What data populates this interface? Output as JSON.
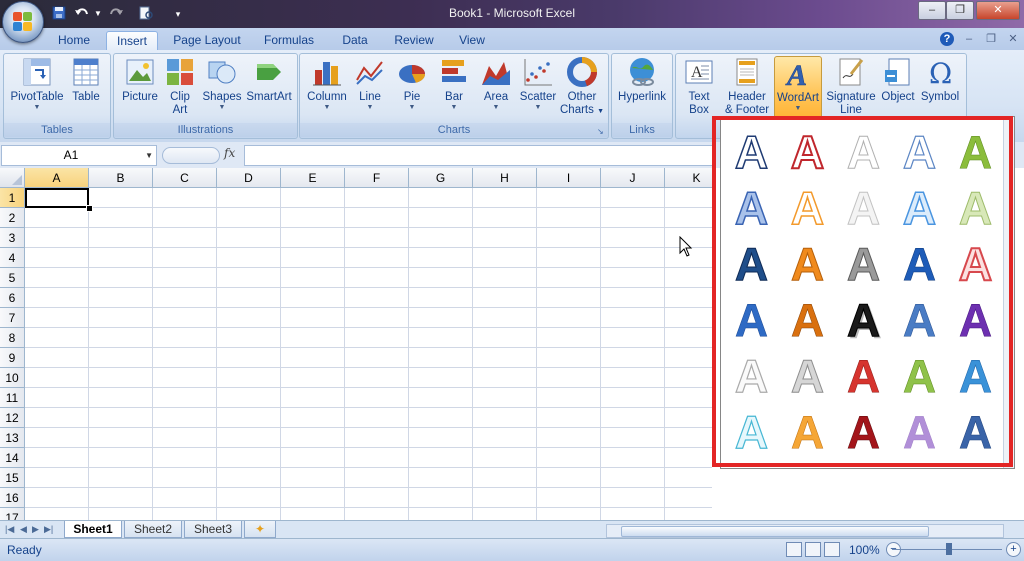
{
  "window": {
    "title": "Book1 - Microsoft Excel"
  },
  "tabs": [
    "Home",
    "Insert",
    "Page Layout",
    "Formulas",
    "Data",
    "Review",
    "View"
  ],
  "active_tab": "Insert",
  "ribbon": {
    "tables": {
      "label": "Tables",
      "pivottable": "PivotTable",
      "table": "Table"
    },
    "illustrations": {
      "label": "Illustrations",
      "picture": "Picture",
      "clipart_1": "Clip",
      "clipart_2": "Art",
      "shapes": "Shapes",
      "smartart": "SmartArt"
    },
    "charts": {
      "label": "Charts",
      "column": "Column",
      "line": "Line",
      "pie": "Pie",
      "bar": "Bar",
      "area": "Area",
      "scatter": "Scatter",
      "other_1": "Other",
      "other_2": "Charts"
    },
    "links": {
      "label": "Links",
      "hyperlink": "Hyperlink"
    },
    "text": {
      "textbox_1": "Text",
      "textbox_2": "Box",
      "header_1": "Header",
      "header_2": "& Footer",
      "wordart": "WordArt",
      "signature_1": "Signature",
      "signature_2": "Line",
      "object": "Object",
      "symbol": "Symbol"
    }
  },
  "formula_bar": {
    "namebox": "A1",
    "fx": "fx",
    "value": ""
  },
  "grid": {
    "columns": [
      "A",
      "B",
      "C",
      "D",
      "E",
      "F",
      "G",
      "H",
      "I",
      "J",
      "K"
    ],
    "rows": [
      "1",
      "2",
      "3",
      "4",
      "5",
      "6",
      "7",
      "8",
      "9",
      "10",
      "11",
      "12",
      "13",
      "14",
      "15",
      "16",
      "17"
    ],
    "active_cell": "A1"
  },
  "wordart_gallery": {
    "glyph": "A",
    "styles": [
      [
        "outline-navy",
        "outline-red",
        "outline-gray",
        "outline-light-blue",
        "fill-green"
      ],
      [
        "outline-blue-gradient",
        "outline-orange",
        "fill-white-gray",
        "outline-sky-blue",
        "fill-pale-green"
      ],
      [
        "fill-navy-white-edge",
        "fill-orange-white-edge",
        "fill-gray-gradient",
        "fill-blue-bevel",
        "outline-pink-red"
      ],
      [
        "fill-blue",
        "fill-orange-brown",
        "fill-black-outline-white",
        "fill-blue-reflection",
        "fill-purple-reflection"
      ],
      [
        "outline-gray-soft",
        "fill-silver",
        "fill-red-bevel",
        "fill-green-bevel",
        "fill-light-blue-reflection"
      ],
      [
        "outline-cyan",
        "fill-orange-gold",
        "fill-dark-red",
        "fill-lavender-blur",
        "fill-steel-blue"
      ]
    ]
  },
  "sheets": {
    "tabs": [
      "Sheet1",
      "Sheet2",
      "Sheet3"
    ],
    "active": "Sheet1"
  },
  "status": {
    "text": "Ready",
    "zoom": "100%"
  }
}
